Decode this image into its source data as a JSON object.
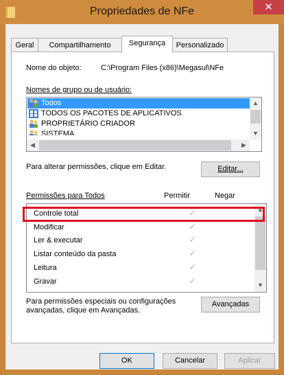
{
  "window": {
    "title": "Propriedades de NFe",
    "close_glyph": "✕"
  },
  "tabs": [
    {
      "label": "Geral"
    },
    {
      "label": "Compartilhamento"
    },
    {
      "label": "Segurança"
    },
    {
      "label": "Personalizado"
    }
  ],
  "security": {
    "object_name_label": "Nome do objeto:",
    "object_name_value": "C:\\Program Files (x86)\\Megasul\\NFe",
    "groups_label": "Nomes de grupo ou de usuário:",
    "groups": [
      {
        "name": "Todos",
        "icon": "users-icon",
        "selected": true
      },
      {
        "name": "TODOS OS PACOTES DE APLICATIVOS",
        "icon": "app-packages-icon",
        "selected": false
      },
      {
        "name": "PROPRIETÁRIO CRIADOR",
        "icon": "users-icon",
        "selected": false
      },
      {
        "name": "SISTEMA",
        "icon": "users-icon",
        "selected": false
      }
    ],
    "change_perm_text": "Para alterar permissões, clique em Editar.",
    "edit_button": "Editar...",
    "perm_header": "Permissões para Todos",
    "col_allow": "Permitir",
    "col_deny": "Negar",
    "permissions": [
      {
        "name": "Controle total",
        "allow": "✓",
        "deny": ""
      },
      {
        "name": "Modificar",
        "allow": "✓",
        "deny": ""
      },
      {
        "name": "Ler & executar",
        "allow": "✓",
        "deny": ""
      },
      {
        "name": "Listar conteúdo da pasta",
        "allow": "✓",
        "deny": ""
      },
      {
        "name": "Leitura",
        "allow": "✓",
        "deny": ""
      },
      {
        "name": "Gravar",
        "allow": "✓",
        "deny": ""
      }
    ],
    "special_text_1": "Para permissões especiais ou configurações",
    "special_text_2": "avançadas, clique em Avançadas.",
    "advanced_button": "Avançadas"
  },
  "footer": {
    "ok": "OK",
    "cancel": "Cancelar",
    "apply": "Aplicar"
  },
  "colors": {
    "title_bar": "#cf8c3e",
    "selection": "#3399ff",
    "highlight": "#e10f1e",
    "close": "#c64047"
  }
}
